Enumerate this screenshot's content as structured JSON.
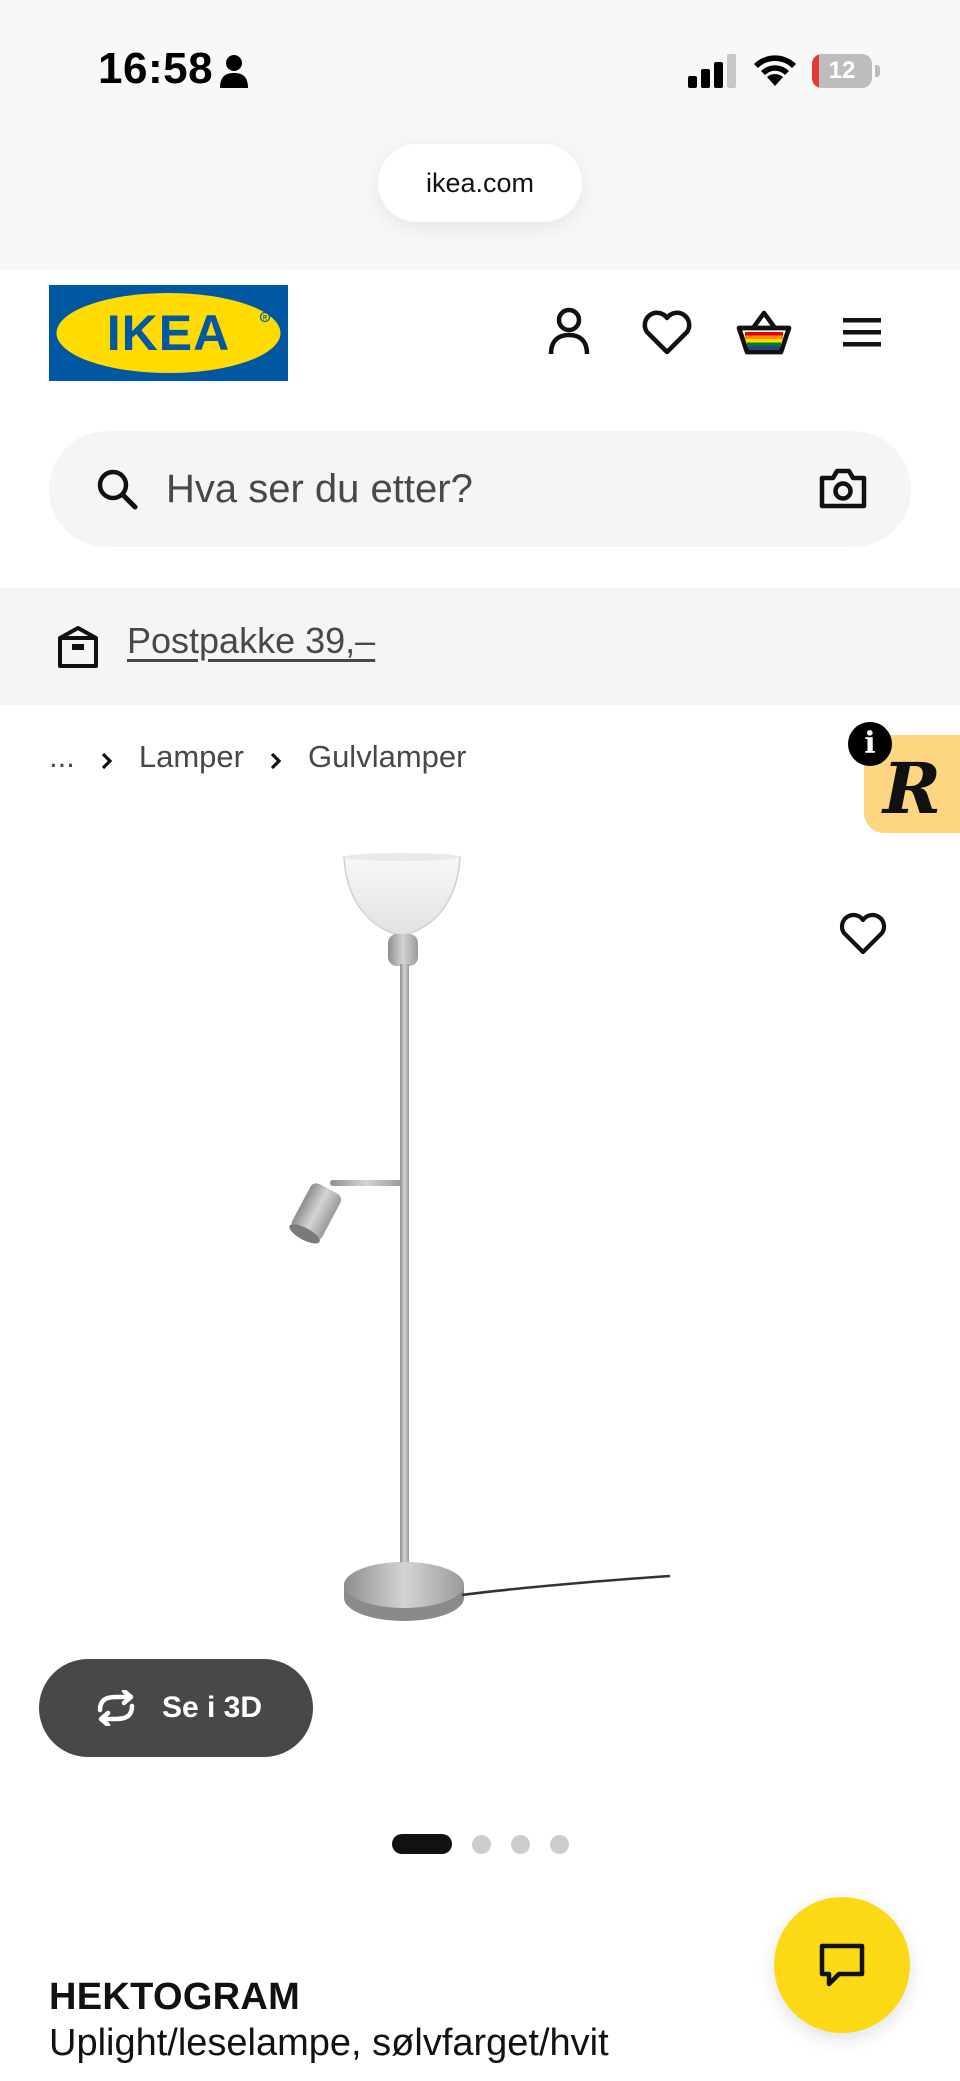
{
  "status_bar": {
    "time": "16:58",
    "battery": "12",
    "battery_fraction": 0.12,
    "icons": [
      "person-icon",
      "signal-icon",
      "wifi-icon",
      "battery-icon"
    ]
  },
  "browser": {
    "url": "ikea.com"
  },
  "header": {
    "logo_text": "IKEA",
    "icons": [
      "user-icon",
      "heart-icon",
      "shopping-bag-icon",
      "menu-icon"
    ]
  },
  "search": {
    "placeholder": "Hva ser du etter?",
    "value": ""
  },
  "promo": {
    "label": "Postpakke 39,–"
  },
  "breadcrumb": {
    "ellipsis": "...",
    "items": [
      "Lamper",
      "Gulvlamper"
    ]
  },
  "product": {
    "name": "HEKTOGRAM",
    "description": "Uplight/leselampe, sølvfarget/hvit",
    "view_3d_label": "Se i 3D",
    "image_count": 4,
    "active_image": 1
  },
  "colors": {
    "ikea_blue": "#0058a3",
    "ikea_yellow": "#ffdb00",
    "chat_yellow": "#fbd914",
    "badge_yellow": "#fed581",
    "button_dark": "#484848"
  }
}
